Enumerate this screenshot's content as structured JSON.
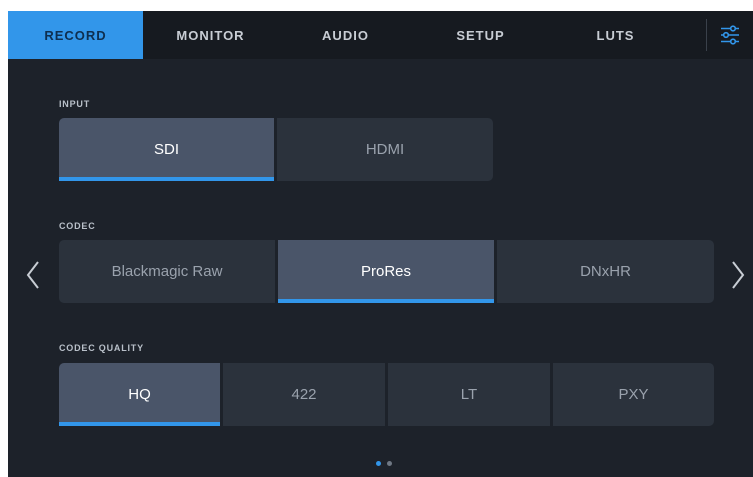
{
  "tabs": [
    {
      "label": "RECORD",
      "active": true
    },
    {
      "label": "MONITOR",
      "active": false
    },
    {
      "label": "AUDIO",
      "active": false
    },
    {
      "label": "SETUP",
      "active": false
    },
    {
      "label": "LUTS",
      "active": false
    }
  ],
  "icons": {
    "menu": "sliders-icon",
    "prev": "chevron-left-icon",
    "next": "chevron-right-icon"
  },
  "colors": {
    "accent": "#3296ea",
    "selected": "#4a5569",
    "unselected": "#2b323c",
    "background": "#1d222a"
  },
  "sections": {
    "input": {
      "label": "INPUT",
      "options": [
        "SDI",
        "HDMI"
      ],
      "selected": "SDI"
    },
    "codec": {
      "label": "CODEC",
      "options": [
        "Blackmagic Raw",
        "ProRes",
        "DNxHR"
      ],
      "selected": "ProRes"
    },
    "quality": {
      "label": "CODEC QUALITY",
      "options": [
        "HQ",
        "422",
        "LT",
        "PXY"
      ],
      "selected": "HQ"
    }
  },
  "pagination": {
    "current": 1,
    "total": 2
  }
}
